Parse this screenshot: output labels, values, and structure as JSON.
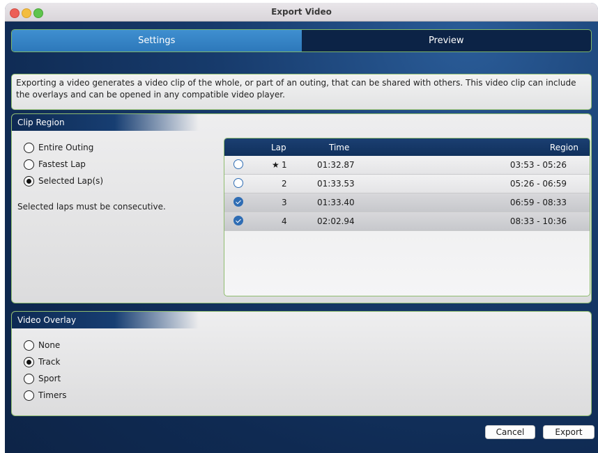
{
  "window": {
    "title": "Export Video"
  },
  "tabs": [
    {
      "label": "Settings",
      "active": true
    },
    {
      "label": "Preview",
      "active": false
    }
  ],
  "description": "Exporting a video generates a video clip of the whole, or part of an outing, that can be shared with others. This video clip can include the overlays and can be opened in any compatible video player.",
  "clip_region": {
    "header": "Clip Region",
    "options": [
      {
        "label": "Entire Outing",
        "selected": false
      },
      {
        "label": "Fastest Lap",
        "selected": false
      },
      {
        "label": "Selected Lap(s)",
        "selected": true
      }
    ],
    "note": "Selected laps must be consecutive.",
    "table": {
      "columns": [
        "Lap",
        "Time",
        "Region"
      ],
      "rows": [
        {
          "checked": false,
          "fastest": true,
          "lap": "1",
          "time": "01:32.87",
          "region": "03:53 - 05:26"
        },
        {
          "checked": false,
          "fastest": false,
          "lap": "2",
          "time": "01:33.53",
          "region": "05:26 - 06:59"
        },
        {
          "checked": true,
          "fastest": false,
          "lap": "3",
          "time": "01:33.40",
          "region": "06:59 - 08:33"
        },
        {
          "checked": true,
          "fastest": false,
          "lap": "4",
          "time": "02:02.94",
          "region": "08:33 - 10:36"
        }
      ]
    }
  },
  "video_overlay": {
    "header": "Video Overlay",
    "options": [
      {
        "label": "None",
        "selected": false
      },
      {
        "label": "Track",
        "selected": true
      },
      {
        "label": "Sport",
        "selected": false
      },
      {
        "label": "Timers",
        "selected": false
      }
    ]
  },
  "buttons": {
    "cancel": "Cancel",
    "export": "Export"
  },
  "colors": {
    "accent": "#2f6db4",
    "tab_active": "#3688c8",
    "border_green": "#8fbd6f",
    "star": "#d89a2b"
  }
}
